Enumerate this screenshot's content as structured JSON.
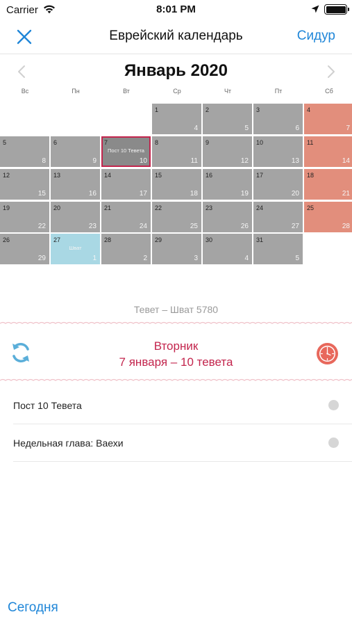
{
  "status_bar": {
    "carrier": "Carrier",
    "time": "8:01 PM"
  },
  "nav": {
    "title": "Еврейский календарь",
    "right_button": "Сидур"
  },
  "calendar": {
    "month_title": "Январь 2020",
    "weekdays": [
      "Вс",
      "Пн",
      "Вт",
      "Ср",
      "Чт",
      "Пт",
      "Сб"
    ],
    "rows": [
      [
        null,
        null,
        null,
        {
          "g": "1",
          "h": "4",
          "type": "normal"
        },
        {
          "g": "2",
          "h": "5",
          "type": "normal"
        },
        {
          "g": "3",
          "h": "6",
          "type": "normal"
        },
        {
          "g": "4",
          "h": "7",
          "type": "saturday"
        }
      ],
      [
        {
          "g": "5",
          "h": "8",
          "type": "normal"
        },
        {
          "g": "6",
          "h": "9",
          "type": "normal"
        },
        {
          "g": "7",
          "h": "10",
          "type": "selected",
          "note": "Пост 10 Тевета"
        },
        {
          "g": "8",
          "h": "11",
          "type": "normal"
        },
        {
          "g": "9",
          "h": "12",
          "type": "normal"
        },
        {
          "g": "10",
          "h": "13",
          "type": "normal"
        },
        {
          "g": "11",
          "h": "14",
          "type": "saturday"
        }
      ],
      [
        {
          "g": "12",
          "h": "15",
          "type": "normal"
        },
        {
          "g": "13",
          "h": "16",
          "type": "normal"
        },
        {
          "g": "14",
          "h": "17",
          "type": "normal"
        },
        {
          "g": "15",
          "h": "18",
          "type": "normal"
        },
        {
          "g": "16",
          "h": "19",
          "type": "normal"
        },
        {
          "g": "17",
          "h": "20",
          "type": "normal"
        },
        {
          "g": "18",
          "h": "21",
          "type": "saturday"
        }
      ],
      [
        {
          "g": "19",
          "h": "22",
          "type": "normal"
        },
        {
          "g": "20",
          "h": "23",
          "type": "normal"
        },
        {
          "g": "21",
          "h": "24",
          "type": "normal"
        },
        {
          "g": "22",
          "h": "25",
          "type": "normal"
        },
        {
          "g": "23",
          "h": "26",
          "type": "normal"
        },
        {
          "g": "24",
          "h": "27",
          "type": "normal"
        },
        {
          "g": "25",
          "h": "28",
          "type": "saturday"
        }
      ],
      [
        {
          "g": "26",
          "h": "29",
          "type": "normal"
        },
        {
          "g": "27",
          "h": "1",
          "type": "shvat",
          "note": "Шват"
        },
        {
          "g": "28",
          "h": "2",
          "type": "normal"
        },
        {
          "g": "29",
          "h": "3",
          "type": "normal"
        },
        {
          "g": "30",
          "h": "4",
          "type": "normal"
        },
        {
          "g": "31",
          "h": "5",
          "type": "normal"
        },
        null
      ]
    ],
    "hebrew_months": "Тевет – Шват 5780"
  },
  "selected_day": {
    "weekday": "Вторник",
    "date": "7 января – 10 тевета"
  },
  "events": [
    {
      "label": "Пост 10 Тевета"
    },
    {
      "label": "Недельная глава: Ваехи"
    }
  ],
  "footer": {
    "today_button": "Сегодня"
  },
  "colors": {
    "accent_blue": "#1f86d8",
    "accent_red": "#c3254d",
    "cell_gray": "#a4a4a4",
    "cell_saturday": "#e28e7c",
    "cell_shvat": "#a9d8e4"
  },
  "icons": {
    "close": "close-icon",
    "prev": "chevron-left-icon",
    "next": "chevron-right-icon",
    "sync": "sync-icon",
    "clock": "clock-icon",
    "wifi": "wifi-icon",
    "location": "location-arrow-icon",
    "battery": "battery-icon"
  }
}
